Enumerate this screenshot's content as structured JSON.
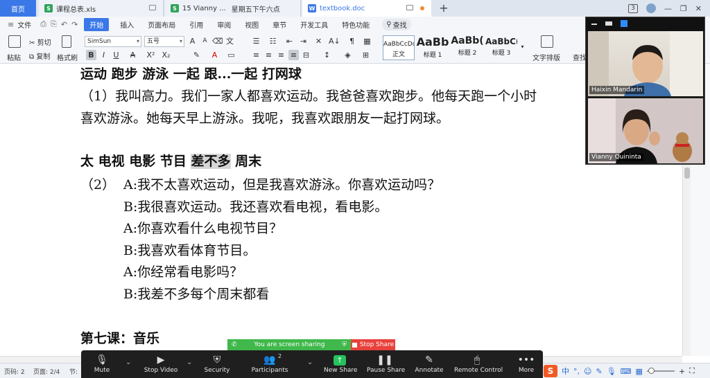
{
  "tabs": {
    "home": "首页",
    "file1": "课程总表.xls",
    "file2": "15 Vianny ...",
    "file2_sub": "星期五下午六点",
    "file3": "textbook.doc",
    "new_tab": "+",
    "win_badge": "3"
  },
  "menu": {
    "file": "文件",
    "start": "开始",
    "insert": "插入",
    "page_layout": "页面布局",
    "references": "引用",
    "review": "审阅",
    "view": "视图",
    "section": "章节",
    "dev_tools": "开发工具",
    "special": "特色功能",
    "search": "查找"
  },
  "ribbon": {
    "paste": "粘贴",
    "cut": "剪切",
    "copy": "复制",
    "format_painter": "格式刷",
    "font_name": "SimSun",
    "font_size": "五号",
    "styles": [
      {
        "sample": "AaBbCcDd",
        "name": "正文"
      },
      {
        "sample": "AaBb",
        "name": "标题 1"
      },
      {
        "sample": "AaBb(",
        "name": "标题 2"
      },
      {
        "sample": "AaBbC(",
        "name": "标题 3"
      }
    ],
    "text_layout": "文字排版",
    "find": "查找"
  },
  "document": {
    "line_vocab1": "运动  跑步  游泳  一起      跟...一起      打网球",
    "line_p1a": "（1）我叫高力。我们一家人都喜欢运动。我爸爸喜欢跑步。他每天跑一个小时",
    "line_p1b": "喜欢游泳。她每天早上游泳。我呢，我喜欢跟朋友一起打网球。",
    "vocab2_a": "太 电视 电影 节目",
    "vocab2_highlight": "差不多",
    "vocab2_b": "周末",
    "dialog_number": "（2）",
    "dialog": [
      "A:我不太喜欢运动，但是我喜欢游泳。你喜欢运动吗？",
      "B:我很喜欢运动。我还喜欢看电视，看电影。",
      "A:你喜欢看什么电视节目？",
      "B:我喜欢看体育节目。",
      "A:你经常看电影吗？",
      "B:我差不多每个周末都看"
    ],
    "lesson_title": "第七课：音乐"
  },
  "status_bar": {
    "page_code": "页码: 2",
    "page_count": "页面: 2/4",
    "section": "节:"
  },
  "tray": {
    "ime": "中",
    "zoom_plus": "+"
  },
  "share_banner": {
    "sharing_text": "You are screen sharing",
    "stop_share": "Stop Share"
  },
  "zoom_toolbar": {
    "mute": "Mute",
    "stop_video": "Stop Video",
    "security": "Security",
    "participants": "Participants",
    "participant_count": "2",
    "new_share": "New Share",
    "pause_share": "Pause Share",
    "annotate": "Annotate",
    "remote_control": "Remote Control",
    "more": "More"
  },
  "video": {
    "participant1": "Haixin Mandarin",
    "participant2": "Vianny Quininta"
  },
  "colors": {
    "accent": "#3b78e7",
    "share_green": "#40b84b",
    "stop_red": "#e8413c",
    "zoom_dark": "#1f1f1f"
  }
}
